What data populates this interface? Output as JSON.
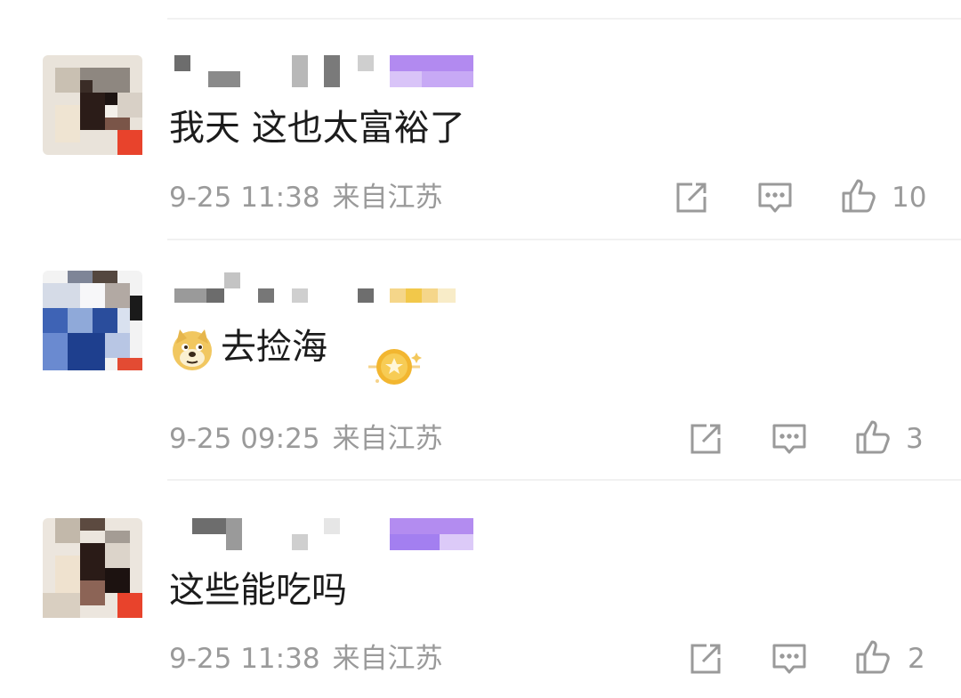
{
  "comments": [
    {
      "text": "我天 这也太富裕了",
      "date": "9-25 11:38",
      "location": "来自江苏",
      "likes": "10"
    },
    {
      "text": "去捡海",
      "emoji": "doge-emoji",
      "date": "9-25 09:25",
      "location": "来自江苏",
      "likes": "3"
    },
    {
      "text": "这些能吃吗",
      "date": "9-25 11:38",
      "location": "来自江苏",
      "likes": "2"
    }
  ],
  "icons": {
    "share": "share-icon",
    "reply": "comment-icon",
    "like": "thumbs-up-icon"
  },
  "colors": {
    "text": "#1c1c1c",
    "meta": "#9a9a9a",
    "divider": "#f1f1f1"
  }
}
